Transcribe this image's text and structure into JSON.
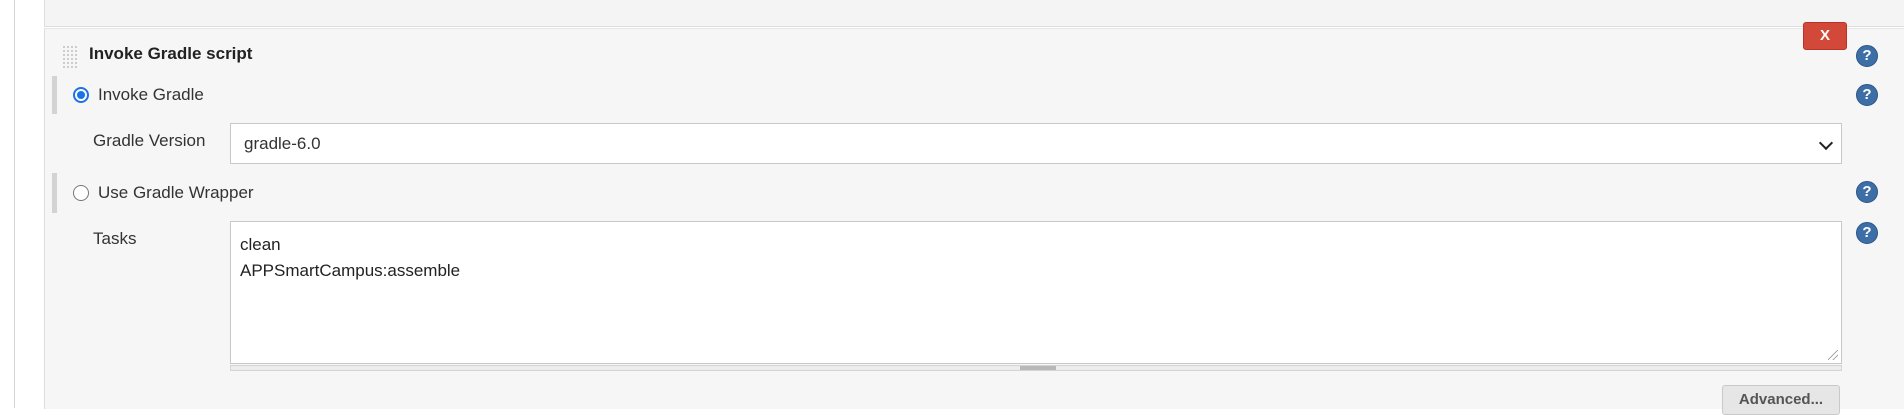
{
  "build_step": {
    "title": "Invoke Gradle script",
    "delete_label": "X",
    "help_glyph": "?",
    "options": {
      "invoke_gradle": {
        "label": "Invoke Gradle",
        "selected": true
      },
      "use_wrapper": {
        "label": "Use Gradle Wrapper",
        "selected": false
      }
    },
    "gradle_version": {
      "label": "Gradle Version",
      "value": "gradle-6.0"
    },
    "tasks": {
      "label": "Tasks",
      "value": "clean\nAPPSmartCampus:assemble"
    },
    "advanced_label": "Advanced..."
  },
  "colors": {
    "delete_button": "#d24939",
    "help_icon": "#3d6fa6",
    "radio_selected": "#1a73e8",
    "panel_background": "#f6f6f6"
  },
  "icons": [
    "help-icon",
    "close-icon",
    "drag-grip-icon",
    "chevron-down-icon"
  ]
}
